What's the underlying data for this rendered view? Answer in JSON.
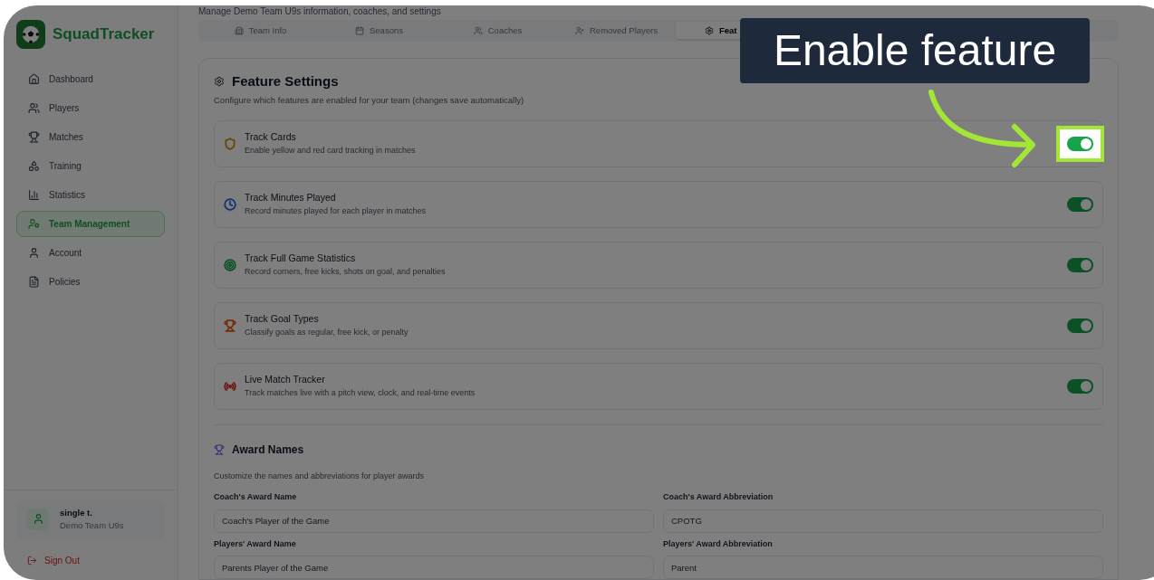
{
  "app": {
    "name": "SquadTracker"
  },
  "sidebar": {
    "items": [
      {
        "label": "Dashboard",
        "selected": false
      },
      {
        "label": "Players",
        "selected": false
      },
      {
        "label": "Matches",
        "selected": false
      },
      {
        "label": "Training",
        "selected": false
      },
      {
        "label": "Statistics",
        "selected": false
      },
      {
        "label": "Team Management",
        "selected": true
      },
      {
        "label": "Account",
        "selected": false
      },
      {
        "label": "Policies",
        "selected": false
      }
    ],
    "user": {
      "name": "single t.",
      "team": "Demo Team U9s"
    },
    "sign_out": "Sign Out"
  },
  "page": {
    "subtitle": "Manage Demo Team U9s information, coaches, and settings"
  },
  "tabs": [
    {
      "label": "Team Info",
      "selected": false
    },
    {
      "label": "Seasons",
      "selected": false
    },
    {
      "label": "Coaches",
      "selected": false
    },
    {
      "label": "Removed Players",
      "selected": false
    },
    {
      "label": "Feat",
      "selected": true
    }
  ],
  "feature_settings": {
    "title": "Feature Settings",
    "description": "Configure which features are enabled for your team (changes save automatically)",
    "features": [
      {
        "name": "Track Cards",
        "description": "Enable yellow and red card tracking in matches",
        "color": "#654502",
        "on": true,
        "highlighted": true
      },
      {
        "name": "Track Minutes Played",
        "description": "Record minutes played for each player in matches",
        "color": "#123175",
        "on": true,
        "highlighted": false
      },
      {
        "name": "Track Full Game Statistics",
        "description": "Record corners, free kicks, shots on goal, and penalties",
        "color": "#0b5125",
        "on": true,
        "highlighted": false
      },
      {
        "name": "Track Goal Types",
        "description": "Classify goals as regular, free kick, or penalty",
        "color": "#752c06",
        "on": true,
        "highlighted": false
      },
      {
        "name": "Live Match Tracker",
        "description": "Track matches live with a pitch view, clock, and real-time events",
        "color": "#6e1313",
        "on": true,
        "highlighted": false
      }
    ]
  },
  "award_names": {
    "title": "Award Names",
    "description": "Customize the names and abbreviations for player awards",
    "fields": [
      {
        "label": "Coach's Award Name",
        "value": "Coach's Player of the Game"
      },
      {
        "label": "Coach's Award Abbreviation",
        "value": "CPOTG"
      },
      {
        "label": "Players' Award Name",
        "value": "Parents Player of the Game"
      },
      {
        "label": "Players' Award Abbreviation",
        "value": "Parent"
      }
    ]
  },
  "callout": {
    "text": "Enable feature"
  }
}
